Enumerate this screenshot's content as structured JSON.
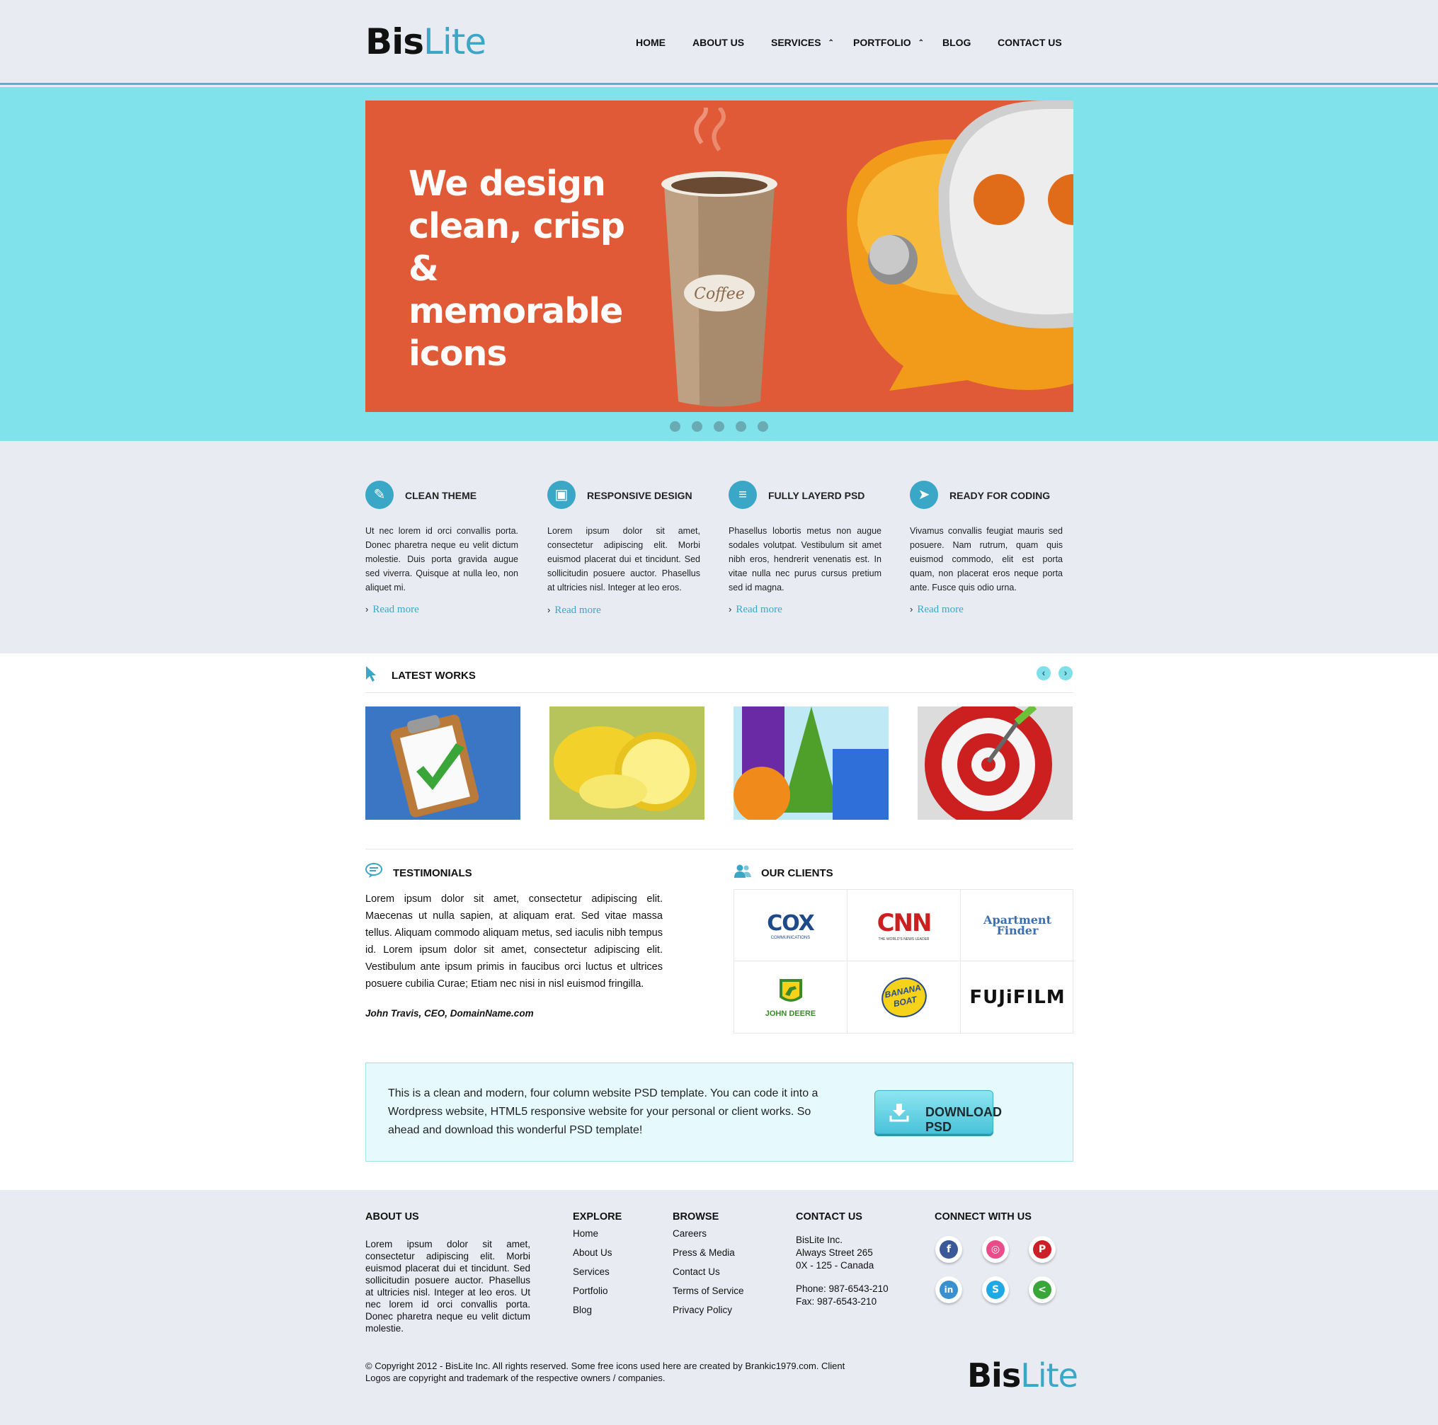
{
  "brand": {
    "part1": "Bis",
    "part2": "Lite"
  },
  "nav": [
    {
      "label": "HOME"
    },
    {
      "label": "ABOUT US"
    },
    {
      "label": "SERVICES",
      "caret": "⌃"
    },
    {
      "label": "PORTFOLIO",
      "caret": "⌃"
    },
    {
      "label": "BLOG"
    },
    {
      "label": "CONTACT US"
    }
  ],
  "hero": {
    "headline": "We design clean, crisp & memorable icons",
    "cup_label": "Coffee",
    "slide_count": 5
  },
  "features": [
    {
      "title": "CLEAN THEME",
      "icon": "pencil-icon",
      "text": "Ut nec lorem id orci convallis porta. Donec pharetra neque eu velit dictum molestie. Duis porta gravida augue sed viverra. Quisque at nulla leo, non aliquet mi.",
      "link": "Read more"
    },
    {
      "title": "RESPONSIVE DESIGN",
      "icon": "screen-icon",
      "text": "Lorem ipsum dolor sit amet, consectetur adipiscing elit. Morbi euismod placerat dui et tincidunt. Sed sollicitudin posuere auctor. Phasellus at ultricies nisl. Integer at leo eros.",
      "link": "Read more"
    },
    {
      "title": "FULLY LAYERD PSD",
      "icon": "layers-icon",
      "text": "Phasellus lobortis metus non augue sodales volutpat. Vestibulum sit amet nibh eros, hendrerit venenatis est. In vitae nulla nec purus cursus pretium sed id magna.",
      "link": "Read more"
    },
    {
      "title": "READY FOR CODING",
      "icon": "cursor-icon",
      "text": "Vivamus convallis feugiat mauris sed posuere. Nam rutrum, quam quis euismod commodo, elit est porta quam, non placerat eros neque porta ante. Fusce quis odio urna.",
      "link": "Read more"
    }
  ],
  "latest_works": {
    "title": "LATEST WORKS",
    "prev": "‹",
    "next": "›",
    "items": [
      {
        "icon": "clipboard-check-icon"
      },
      {
        "icon": "lemon-icon"
      },
      {
        "icon": "shapes-icon"
      },
      {
        "icon": "target-icon"
      }
    ]
  },
  "testimonials": {
    "title": "TESTIMONIALS",
    "quote": "Lorem ipsum dolor sit amet, consectetur adipiscing elit. Maecenas ut nulla sapien, at aliquam erat. Sed vitae massa tellus. Aliquam commodo aliquam metus, sed iaculis nibh tempus id. Lorem ipsum dolor sit amet, consectetur adipiscing elit. Vestibulum ante ipsum primis in faucibus orci luctus et ultrices posuere cubilia Curae; Etiam nec nisi in nisl euismod fringilla.",
    "author": "John Travis, CEO, DomainName.com"
  },
  "clients": {
    "title": "OUR CLIENTS",
    "logos": [
      {
        "name": "COX",
        "sub": "COMMUNICATIONS"
      },
      {
        "name": "CNN",
        "sub": "THE WORLD'S NEWS LEADER"
      },
      {
        "name": "Apartment",
        "sub": "Finder"
      },
      {
        "name": "JOHN DEERE"
      },
      {
        "name": "BANANA",
        "sub": "BOAT"
      },
      {
        "name": "FUJiFILM"
      }
    ]
  },
  "cta": {
    "text": "This is a clean and modern, four column website PSD template. You can code it into a Wordpress website, HTML5 responsive website for your personal or client works. So ahead and download this wonderful PSD template!",
    "button": "DOWNLOAD PSD"
  },
  "footer": {
    "about_title": "ABOUT US",
    "about_text": "Lorem ipsum dolor sit amet, consectetur adipiscing elit. Morbi euismod placerat dui et tincidunt. Sed sollicitudin posuere auctor. Phasellus at ultricies nisl. Integer at leo eros. Ut nec lorem id orci convallis porta. Donec pharetra neque eu velit dictum molestie.",
    "explore_title": "EXPLORE",
    "explore": [
      "Home",
      "About Us",
      "Services",
      "Portfolio",
      "Blog"
    ],
    "browse_title": "BROWSE",
    "browse": [
      "Careers",
      "Press & Media",
      "Contact Us",
      "Terms of Service",
      "Privacy Policy"
    ],
    "contact_title": "CONTACT US",
    "contact_company": "BisLite Inc.",
    "contact_street": "Always Street 265",
    "contact_city": "0X - 125 - Canada",
    "contact_phone": "Phone: 987-6543-210",
    "contact_fax": "Fax: 987-6543-210",
    "connect_title": "CONNECT WITH US",
    "social": [
      {
        "name": "facebook",
        "glyph": "f",
        "color": "#3b5998"
      },
      {
        "name": "dribbble",
        "glyph": "◎",
        "color": "#ea4c89"
      },
      {
        "name": "pinterest",
        "glyph": "P",
        "color": "#cb2027"
      },
      {
        "name": "linkedin",
        "glyph": "in",
        "color": "#3a8fcf"
      },
      {
        "name": "skype",
        "glyph": "S",
        "color": "#1fa8e6"
      },
      {
        "name": "share",
        "glyph": "<",
        "color": "#3aa63a"
      }
    ],
    "copyright": "© Copyright 2012 - BisLite Inc. All rights reserved. Some free icons used here are created by Brankic1979.com. Client Logos are copyright and trademark of the respective owners / companies."
  },
  "colors": {
    "accent": "#3aa7c6",
    "hero_bg": "#80e3ec",
    "slide_bg": "#e05a37",
    "page_bg": "#e9ebf2"
  }
}
